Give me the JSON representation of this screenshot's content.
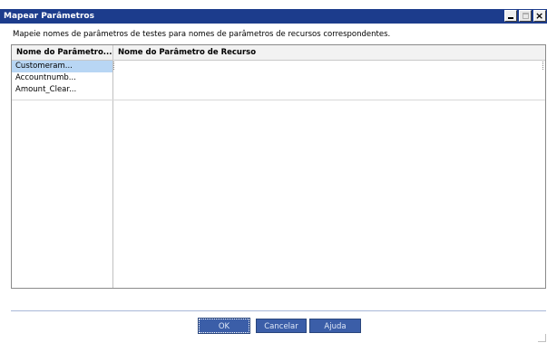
{
  "window": {
    "title": "Mapear Parâmetros"
  },
  "instruction": "Mapeie nomes de parâmetros de testes para nomes de parâmetros de recursos correspondentes.",
  "grid": {
    "columns": [
      "Nome do Parâmetro...",
      "Nome do Parâmetro de Recurso"
    ],
    "rows": [
      {
        "test_param": "Customeram...",
        "resource_param": "",
        "selected": true
      },
      {
        "test_param": "Accountnumb...",
        "resource_param": "",
        "selected": false
      },
      {
        "test_param": "Amount_Clear...",
        "resource_param": "",
        "selected": false
      }
    ]
  },
  "buttons": {
    "ok": "OK",
    "cancel": "Cancelar",
    "help": "Ajuda"
  },
  "colors": {
    "titlebar": "#1c3c8c",
    "selection": "#b8d6f4",
    "button": "#3b5ea8"
  }
}
